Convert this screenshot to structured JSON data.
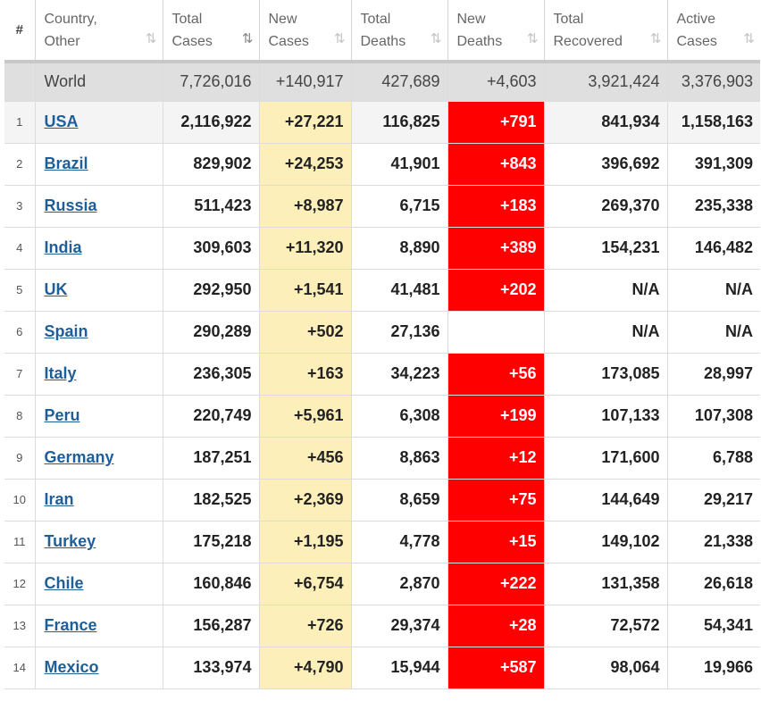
{
  "headers": [
    {
      "label": "#",
      "sortable": false
    },
    {
      "label": "Country,\nOther",
      "sortable": true
    },
    {
      "label": "Total\nCases",
      "sortable": true,
      "active": true
    },
    {
      "label": "New\nCases",
      "sortable": true
    },
    {
      "label": "Total\nDeaths",
      "sortable": true
    },
    {
      "label": "New\nDeaths",
      "sortable": true
    },
    {
      "label": "Total\nRecovered",
      "sortable": true
    },
    {
      "label": "Active\nCases",
      "sortable": true
    }
  ],
  "sort_icon": "⇅",
  "sort_icon_active": "⇅",
  "world": {
    "country": "World",
    "total_cases": "7,726,016",
    "new_cases": "+140,917",
    "total_deaths": "427,689",
    "new_deaths": "+4,603",
    "total_recovered": "3,921,424",
    "active_cases": "3,376,903"
  },
  "rows": [
    {
      "idx": "1",
      "country": "USA",
      "total_cases": "2,116,922",
      "new_cases": "+27,221",
      "total_deaths": "116,825",
      "new_deaths": "+791",
      "total_recovered": "841,934",
      "active_cases": "1,158,163"
    },
    {
      "idx": "2",
      "country": "Brazil",
      "total_cases": "829,902",
      "new_cases": "+24,253",
      "total_deaths": "41,901",
      "new_deaths": "+843",
      "total_recovered": "396,692",
      "active_cases": "391,309"
    },
    {
      "idx": "3",
      "country": "Russia",
      "total_cases": "511,423",
      "new_cases": "+8,987",
      "total_deaths": "6,715",
      "new_deaths": "+183",
      "total_recovered": "269,370",
      "active_cases": "235,338"
    },
    {
      "idx": "4",
      "country": "India",
      "total_cases": "309,603",
      "new_cases": "+11,320",
      "total_deaths": "8,890",
      "new_deaths": "+389",
      "total_recovered": "154,231",
      "active_cases": "146,482"
    },
    {
      "idx": "5",
      "country": "UK",
      "total_cases": "292,950",
      "new_cases": "+1,541",
      "total_deaths": "41,481",
      "new_deaths": "+202",
      "total_recovered": "N/A",
      "active_cases": "N/A"
    },
    {
      "idx": "6",
      "country": "Spain",
      "total_cases": "290,289",
      "new_cases": "+502",
      "total_deaths": "27,136",
      "new_deaths": "",
      "total_recovered": "N/A",
      "active_cases": "N/A"
    },
    {
      "idx": "7",
      "country": "Italy",
      "total_cases": "236,305",
      "new_cases": "+163",
      "total_deaths": "34,223",
      "new_deaths": "+56",
      "total_recovered": "173,085",
      "active_cases": "28,997"
    },
    {
      "idx": "8",
      "country": "Peru",
      "total_cases": "220,749",
      "new_cases": "+5,961",
      "total_deaths": "6,308",
      "new_deaths": "+199",
      "total_recovered": "107,133",
      "active_cases": "107,308"
    },
    {
      "idx": "9",
      "country": "Germany",
      "total_cases": "187,251",
      "new_cases": "+456",
      "total_deaths": "8,863",
      "new_deaths": "+12",
      "total_recovered": "171,600",
      "active_cases": "6,788"
    },
    {
      "idx": "10",
      "country": "Iran",
      "total_cases": "182,525",
      "new_cases": "+2,369",
      "total_deaths": "8,659",
      "new_deaths": "+75",
      "total_recovered": "144,649",
      "active_cases": "29,217"
    },
    {
      "idx": "11",
      "country": "Turkey",
      "total_cases": "175,218",
      "new_cases": "+1,195",
      "total_deaths": "4,778",
      "new_deaths": "+15",
      "total_recovered": "149,102",
      "active_cases": "21,338"
    },
    {
      "idx": "12",
      "country": "Chile",
      "total_cases": "160,846",
      "new_cases": "+6,754",
      "total_deaths": "2,870",
      "new_deaths": "+222",
      "total_recovered": "131,358",
      "active_cases": "26,618"
    },
    {
      "idx": "13",
      "country": "France",
      "total_cases": "156,287",
      "new_cases": "+726",
      "total_deaths": "29,374",
      "new_deaths": "+28",
      "total_recovered": "72,572",
      "active_cases": "54,341"
    },
    {
      "idx": "14",
      "country": "Mexico",
      "total_cases": "133,974",
      "new_cases": "+4,790",
      "total_deaths": "15,944",
      "new_deaths": "+587",
      "total_recovered": "98,064",
      "active_cases": "19,966"
    }
  ],
  "colors": {
    "new_cases_bg": "#fcefb9",
    "new_deaths_bg": "#ff0000",
    "link": "#1f5e97",
    "world_bg": "#dfdfdf"
  }
}
